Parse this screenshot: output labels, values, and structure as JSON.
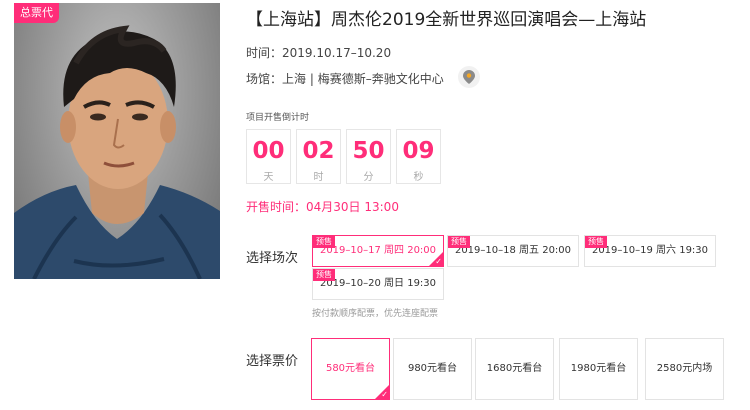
{
  "poster": {
    "badge": "总票代"
  },
  "event": {
    "title": "【上海站】周杰伦2019全新世界巡回演唱会—上海站",
    "time_label": "时间：",
    "time_value": "2019.10.17–10.20",
    "venue_label": "场馆：",
    "venue_value": "上海 | 梅赛德斯–奔驰文化中心",
    "location_icon": "map-pin-icon"
  },
  "countdown": {
    "label": "项目开售倒计时",
    "units": [
      {
        "value": "00",
        "unit": "天"
      },
      {
        "value": "02",
        "unit": "时"
      },
      {
        "value": "50",
        "unit": "分"
      },
      {
        "value": "09",
        "unit": "秒"
      }
    ]
  },
  "sale": {
    "label": "开售时间：",
    "value": "04月30日 13:00"
  },
  "sessions": {
    "label": "选择场次",
    "items": [
      {
        "tag": "预售",
        "text": "2019–10–17 周四 20:00",
        "selected": true
      },
      {
        "tag": "预售",
        "text": "2019–10–18 周五 20:00",
        "selected": false
      },
      {
        "tag": "预售",
        "text": "2019–10–19 周六 19:30",
        "selected": false
      },
      {
        "tag": "预售",
        "text": "2019–10–20 周日 19:30",
        "selected": false
      }
    ],
    "hint": "按付款顺序配票，优先连座配票"
  },
  "prices": {
    "label": "选择票价",
    "items": [
      {
        "text": "580元看台",
        "selected": true
      },
      {
        "text": "980元看台",
        "selected": false
      },
      {
        "text": "1680元看台",
        "selected": false
      },
      {
        "text": "1980元看台",
        "selected": false
      },
      {
        "text": "2580元内场",
        "selected": false
      }
    ]
  },
  "colors": {
    "accent": "#ff2d79",
    "border": "#e3e3e3",
    "muted": "#9a9a9a"
  }
}
